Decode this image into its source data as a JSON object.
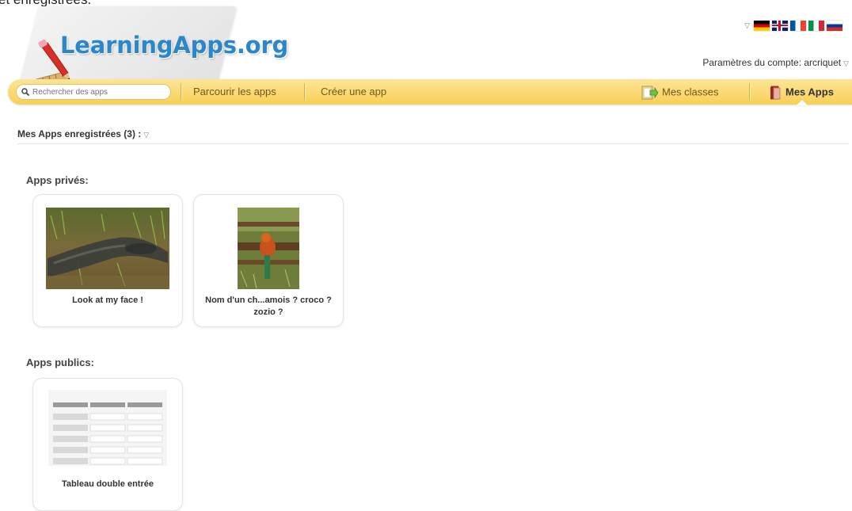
{
  "header": {
    "cut_text": "et enregistrées.",
    "logo_text": "LearningApps.org",
    "account_label": "Paramètres du compte: arcriquet",
    "languages": [
      {
        "name": "de-flag-icon",
        "colors": [
          "#000000",
          "#dd0000",
          "#ffce00"
        ]
      },
      {
        "name": "uk-flag-icon",
        "colors": [
          "#012169",
          "#ffffff",
          "#c8102e"
        ]
      },
      {
        "name": "fr-flag-icon",
        "colors": [
          "#0055a4",
          "#ffffff",
          "#ef4135"
        ]
      },
      {
        "name": "it-flag-icon",
        "colors": [
          "#009246",
          "#ffffff",
          "#ce2b37"
        ]
      },
      {
        "name": "ru-flag-icon",
        "colors": [
          "#ffffff",
          "#0039a6",
          "#d52b1e"
        ]
      }
    ]
  },
  "nav": {
    "search_placeholder": "Rechercher des apps",
    "browse": "Parcourir les apps",
    "create": "Créer une app",
    "classes": "Mes classes",
    "my_apps": "Mes Apps"
  },
  "main": {
    "section_title": "Mes Apps enregistrées (3) :",
    "private_title": "Apps privés:",
    "public_title": "Apps publics:",
    "private_apps": [
      {
        "title": "Look at my face !"
      },
      {
        "title": "Nom d'un ch...amois ? croco ? zozio ?"
      }
    ],
    "public_apps": [
      {
        "title": "Tableau double entrée"
      }
    ]
  },
  "colors": {
    "accent": "#2b87c9",
    "nav_bar": "#f8cf57"
  }
}
